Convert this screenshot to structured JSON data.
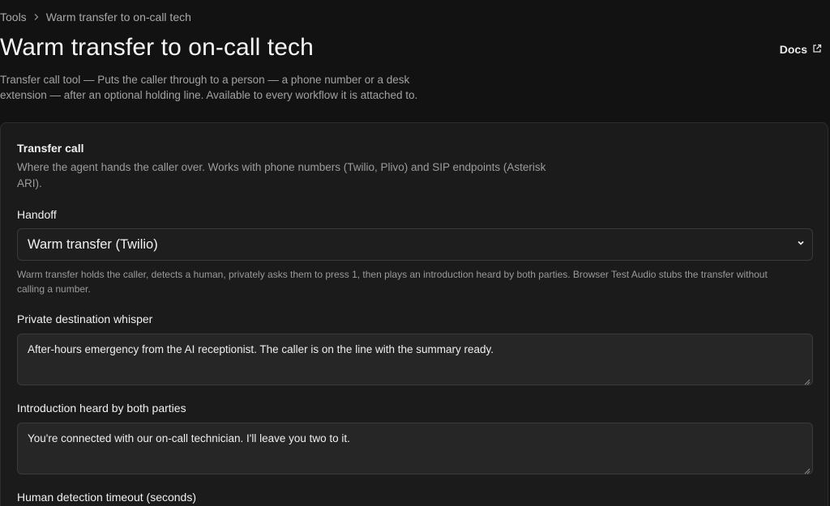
{
  "breadcrumb": {
    "root": "Tools",
    "current": "Warm transfer to on-call tech"
  },
  "header": {
    "title": "Warm transfer to on-call tech",
    "docs_label": "Docs",
    "description": "Transfer call tool — Puts the caller through to a person — a phone number or a desk extension — after an optional holding line. Available to every workflow it is attached to."
  },
  "card": {
    "title": "Transfer call",
    "description": "Where the agent hands the caller over. Works with phone numbers (Twilio, Plivo) and SIP endpoints (Asterisk ARI).",
    "handoff": {
      "label": "Handoff",
      "value": "Warm transfer (Twilio)",
      "help": "Warm transfer holds the caller, detects a human, privately asks them to press 1, then plays an introduction heard by both parties. Browser Test Audio stubs the transfer without calling a number."
    },
    "whisper": {
      "label": "Private destination whisper",
      "value": "After-hours emergency from the AI receptionist. The caller is on the line with the summary ready."
    },
    "introduction": {
      "label": "Introduction heard by both parties",
      "value": "You're connected with our on-call technician. I'll leave you two to it."
    },
    "timeout": {
      "label": "Human detection timeout (seconds)"
    }
  },
  "icons": {
    "breadcrumb_separator": "chevron-right-icon",
    "docs": "external-link-icon",
    "select": "chevron-down-icon"
  },
  "colors": {
    "background": "#121212",
    "card": "#1b1b1b",
    "input": "#262626",
    "border": "#3a3a3a"
  }
}
